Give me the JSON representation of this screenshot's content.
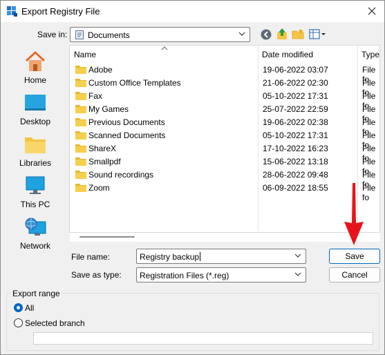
{
  "window": {
    "title": "Export Registry File"
  },
  "toolbar": {
    "save_in_label": "Save in:",
    "location": "Documents",
    "icons": [
      "back-icon",
      "up-folder-icon",
      "new-folder-icon",
      "view-menu-icon"
    ]
  },
  "places": [
    {
      "label": "Home",
      "icon": "home-icon"
    },
    {
      "label": "Desktop",
      "icon": "desktop-icon"
    },
    {
      "label": "Libraries",
      "icon": "libraries-icon"
    },
    {
      "label": "This PC",
      "icon": "this-pc-icon"
    },
    {
      "label": "Network",
      "icon": "network-icon"
    }
  ],
  "filelist": {
    "columns": {
      "name": "Name",
      "date": "Date modified",
      "type": "Type"
    },
    "rows": [
      {
        "name": "Adobe",
        "date": "19-06-2022 03:07",
        "type": "File fo"
      },
      {
        "name": "Custom Office Templates",
        "date": "21-06-2022 02:30",
        "type": "File fo"
      },
      {
        "name": "Fax",
        "date": "05-10-2022 17:31",
        "type": "File fo"
      },
      {
        "name": "My Games",
        "date": "25-07-2022 22:59",
        "type": "File fo"
      },
      {
        "name": "Previous Documents",
        "date": "19-06-2022 02:38",
        "type": "File fo"
      },
      {
        "name": "Scanned Documents",
        "date": "05-10-2022 17:31",
        "type": "File fo"
      },
      {
        "name": "ShareX",
        "date": "17-10-2022 16:23",
        "type": "File fo"
      },
      {
        "name": "Smallpdf",
        "date": "15-06-2022 13:18",
        "type": "File fo"
      },
      {
        "name": "Sound recordings",
        "date": "28-06-2022 09:48",
        "type": "File fo"
      },
      {
        "name": "Zoom",
        "date": "06-09-2022 18:55",
        "type": "File fo"
      }
    ]
  },
  "form": {
    "file_name_label": "File name:",
    "file_name_value": "Registry backup",
    "save_as_type_label": "Save as type:",
    "save_as_type_value": "Registration Files (*.reg)"
  },
  "buttons": {
    "save": "Save",
    "cancel": "Cancel"
  },
  "export_range": {
    "legend": "Export range",
    "all_label": "All",
    "selected_branch_label": "Selected branch",
    "selected": "all",
    "branch_value": ""
  },
  "colors": {
    "accent": "#0067c0",
    "folder": "#f5c542",
    "annotation_arrow": "#e8131a"
  }
}
